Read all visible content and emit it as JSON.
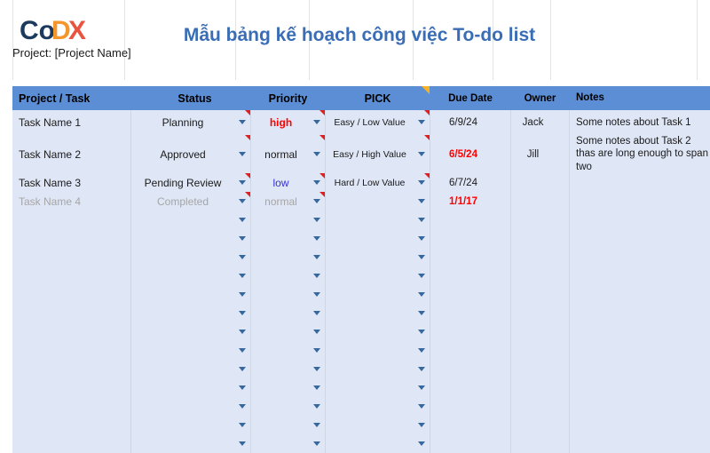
{
  "brand": {
    "logo_text_1": "Co",
    "logo_text_2": "D",
    "logo_text_3": "X",
    "logo_name": "CoDX",
    "color_navy": "#1c3a5e",
    "color_orange": "#f5962d",
    "color_red": "#e8543f"
  },
  "header": {
    "project_label": "Project: [Project Name]",
    "title": "Mẫu bảng kế hoạch công việc To-do list",
    "title_color": "#3a6db5"
  },
  "table": {
    "header_bg": "#5b8ed4",
    "body_bg": "#dfe6f5",
    "columns": [
      {
        "key": "task",
        "label": "Project / Task"
      },
      {
        "key": "status",
        "label": "Status"
      },
      {
        "key": "pri",
        "label": "Priority"
      },
      {
        "key": "pick",
        "label": "PICK",
        "comment_marker": "yellow"
      },
      {
        "key": "due",
        "label": "Due Date"
      },
      {
        "key": "owner",
        "label": "Owner"
      },
      {
        "key": "notes",
        "label": "Notes"
      }
    ],
    "rows": [
      {
        "task": "Task Name 1",
        "status": "Planning",
        "priority": "high",
        "priority_style": "red",
        "pick": "Easy / Low Value",
        "due": "6/9/24",
        "due_style": "normal",
        "owner": "Jack",
        "notes": "Some notes about Task 1"
      },
      {
        "task": "Task Name 2",
        "status": "Approved",
        "priority": "normal",
        "priority_style": "normal",
        "pick": "Easy / High Value",
        "due": "6/5/24",
        "due_style": "red",
        "owner": "Jill",
        "notes": "Some notes about Task 2 thas are long enough to span two"
      },
      {
        "task": "Task Name 3",
        "status": "Pending Review",
        "priority": "low",
        "priority_style": "blue",
        "pick": "Hard / Low Value",
        "due": "6/7/24",
        "due_style": "normal",
        "owner": "",
        "notes": ""
      },
      {
        "task": "Task Name 4",
        "status": "Completed",
        "priority": "normal",
        "priority_style": "grey",
        "pick": "",
        "due": "1/1/17",
        "due_style": "red",
        "owner": "",
        "notes": "",
        "row_style": "grey"
      }
    ],
    "empty_row_count": 13,
    "dropdown_icon": "chevron-down-icon",
    "comment_icon": "comment-marker-icon"
  }
}
